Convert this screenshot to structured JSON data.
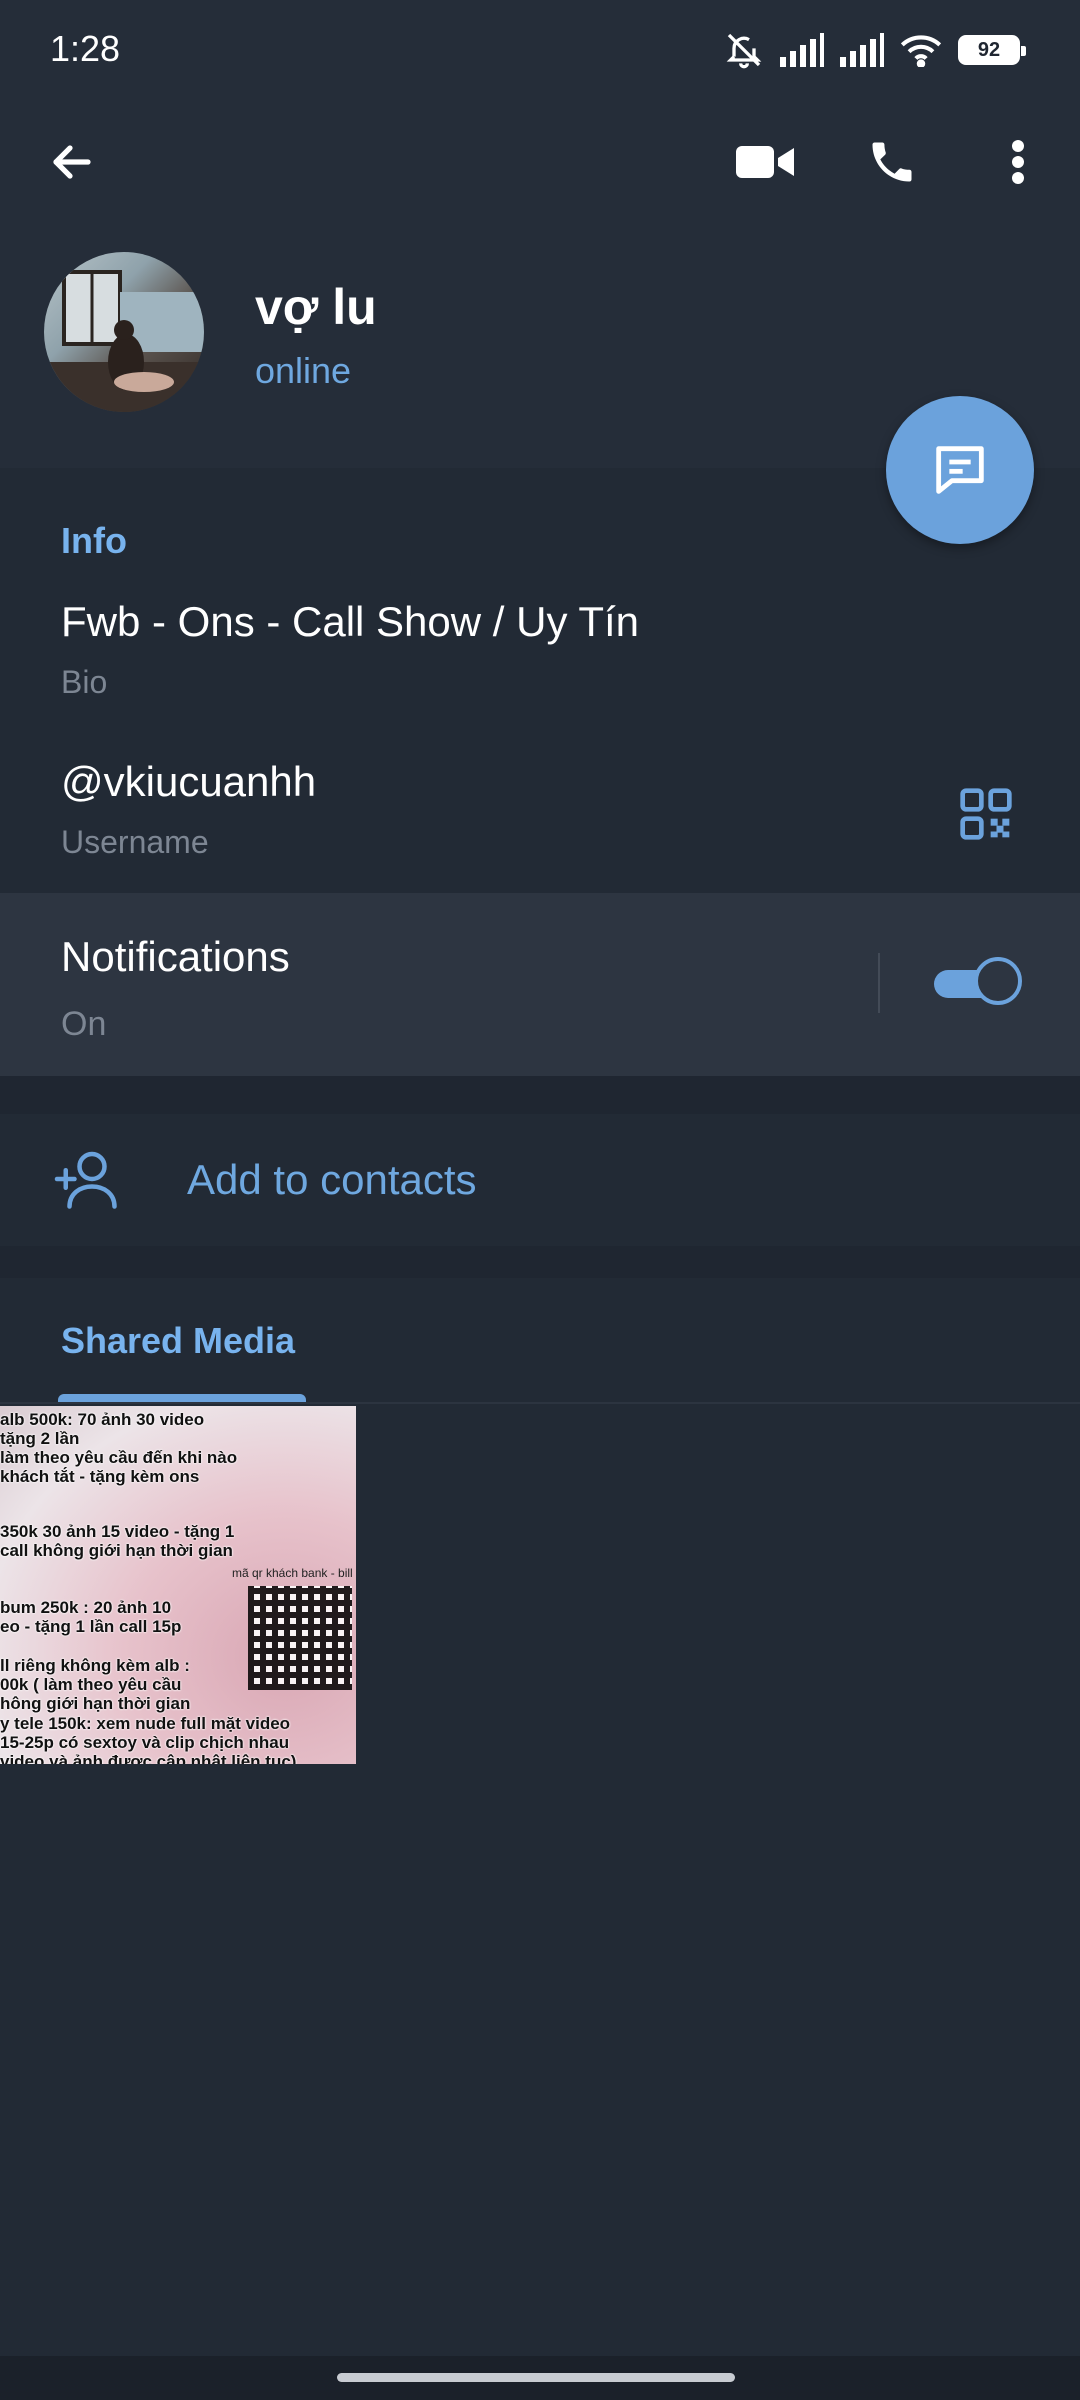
{
  "status_bar": {
    "time": "1:28",
    "battery": "92",
    "icons": [
      "bell-muted-icon",
      "signal-icon",
      "signal-icon",
      "wifi-icon",
      "battery-icon"
    ]
  },
  "toolbar": {
    "icons": [
      "back-arrow-icon",
      "video-call-icon",
      "phone-icon",
      "more-vertical-icon"
    ]
  },
  "profile": {
    "name": "vợ lu",
    "status": "online"
  },
  "info": {
    "title": "Info",
    "bio_value": "Fwb - Ons - Call Show / Uy Tín",
    "bio_label": "Bio",
    "username_value": "@vkiucuanhh",
    "username_label": "Username"
  },
  "notifications": {
    "title": "Notifications",
    "status": "On",
    "enabled": true
  },
  "contacts": {
    "label": "Add to contacts"
  },
  "media": {
    "tab_label": "Shared Media",
    "thumbnail_text": [
      "alb 500k: 70 ảnh 30 video\n      tặng 2 lần\nlàm theo yêu cầu đến khi nào\nkhách tắt - tặng kèm ons",
      "350k 30 ảnh 15 video - tặng 1\n call không giới hạn thời gian",
      "bum 250k : 20 ảnh 10\neo - tặng 1 lần call 15p",
      "ll riêng không kèm alb :\n00k ( làm theo yêu cầu\nhông giới hạn thời gian",
      "y tele 150k: xem nude full mặt video\n 15-25p có sextoy và clip chịch nhau\nvideo và ảnh được cập nhật liên tục)"
    ],
    "qr_caption": "mã qr khách bank - bill"
  },
  "colors": {
    "accent": "#6ba2dc",
    "background": "#1f2631",
    "header": "#252d39"
  }
}
